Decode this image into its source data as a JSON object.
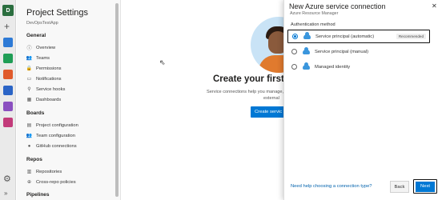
{
  "appbar": {
    "org_initial": "D"
  },
  "settings": {
    "title": "Project Settings",
    "project": "DevOpsTestApp",
    "sections": [
      {
        "label": "General"
      },
      {
        "label": "Boards"
      },
      {
        "label": "Repos"
      },
      {
        "label": "Pipelines"
      }
    ],
    "general_items": [
      "Overview",
      "Teams",
      "Permissions",
      "Notifications",
      "Service hooks",
      "Dashboards"
    ],
    "boards_items": [
      "Project configuration",
      "Team configuration",
      "GitHub connections"
    ],
    "repos_items": [
      "Repositories",
      "Cross-repo policies"
    ]
  },
  "main": {
    "title": "Create your first s",
    "desc_line1": "Service connections help you manage,",
    "desc_line2": "external",
    "create_button": "Create servic"
  },
  "modal": {
    "title": "New Azure service connection",
    "subtitle": "Azure Resource Manager",
    "auth_label": "Authentication method",
    "options": [
      {
        "label": "Service principal (automatic)",
        "badge": "Recommended",
        "selected": true
      },
      {
        "label": "Service principal (manual)",
        "selected": false
      },
      {
        "label": "Managed identity",
        "selected": false
      }
    ],
    "help_link": "Need help choosing a connection type?",
    "back_button": "Back",
    "next_button": "Next"
  },
  "colors": {
    "accent": "#0078d4",
    "org_badge": "#2b6e3f"
  }
}
